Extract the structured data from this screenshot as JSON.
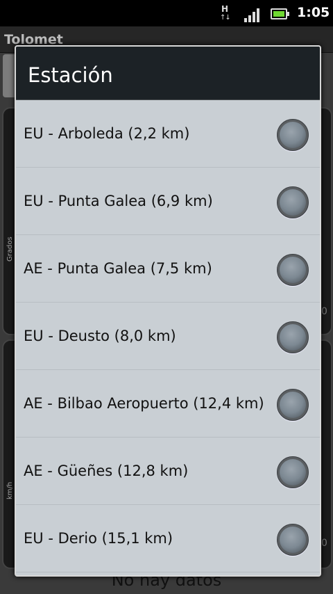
{
  "status_bar": {
    "network_type": "H",
    "network_icon": "hspa-data-icon",
    "signal_icon": "signal-strength-icon",
    "battery_icon": "battery-icon",
    "time": "1:05"
  },
  "app": {
    "title": "Tolomet",
    "panel1_axis_label": "Grados",
    "panel2_axis_label": "km/h",
    "peek_value_1": "0",
    "peek_value_2": "0",
    "empty_message": "No hay datos"
  },
  "dialog": {
    "title": "Estación",
    "stations": [
      {
        "label": "EU - Arboleda (2,2 km)",
        "selected": false
      },
      {
        "label": "EU - Punta Galea (6,9 km)",
        "selected": false
      },
      {
        "label": "AE - Punta Galea (7,5 km)",
        "selected": false
      },
      {
        "label": "EU - Deusto (8,0 km)",
        "selected": false
      },
      {
        "label": "AE - Bilbao Aeropuerto (12,4 km)",
        "selected": false
      },
      {
        "label": "AE - Güeñes (12,8 km)",
        "selected": false
      },
      {
        "label": "EU - Derio (15,1 km)",
        "selected": false
      }
    ]
  }
}
